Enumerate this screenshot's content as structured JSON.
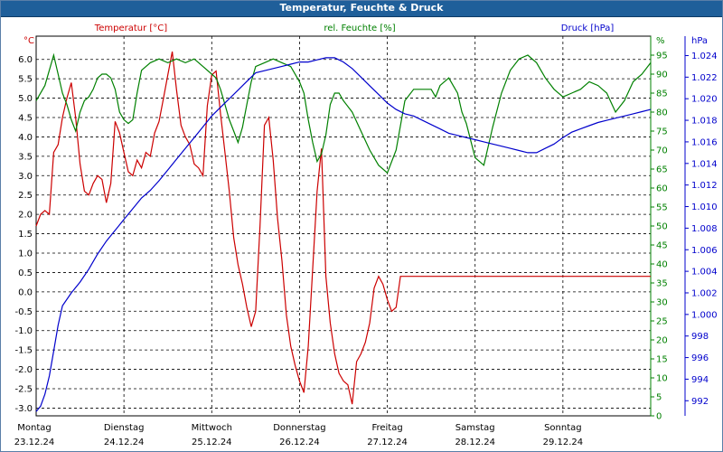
{
  "window": {
    "title": "Temperatur, Feuchte & Druck"
  },
  "colors": {
    "temperature": "#cc0000",
    "humidity": "#008000",
    "pressure": "#0000cc",
    "title_bg": "#1f5f9a",
    "axis_right": "#0000cc"
  },
  "chart_data": {
    "type": "line",
    "title": "Temperatur, Feuchte & Druck",
    "grid": true,
    "axes": {
      "temperature": {
        "label": "Temperatur [°C]",
        "unit": "°C",
        "range": [
          -3.2,
          6.6
        ],
        "ticks": [
          -3.0,
          -2.5,
          -2.0,
          -1.5,
          -1.0,
          -0.5,
          0.0,
          0.5,
          1.0,
          1.5,
          2.0,
          2.5,
          3.0,
          3.5,
          4.0,
          4.5,
          5.0,
          5.5,
          6.0
        ]
      },
      "humidity": {
        "label": "rel. Feuchte [%]",
        "unit": "%",
        "range": [
          0,
          100
        ],
        "ticks": [
          0,
          5,
          10,
          15,
          20,
          25,
          30,
          35,
          40,
          45,
          50,
          55,
          60,
          65,
          70,
          75,
          80,
          85,
          90,
          95
        ]
      },
      "pressure": {
        "label": "Druck [hPa]",
        "unit": "hPa",
        "range": [
          990.6,
          1025.8
        ],
        "ticks": [
          992,
          994,
          996,
          998,
          1000,
          1002,
          1004,
          1006,
          1008,
          1010,
          1012,
          1014,
          1016,
          1018,
          1020,
          1022,
          1024
        ]
      }
    },
    "x_range": [
      0,
      7
    ],
    "days": [
      {
        "day": "Montag",
        "date": "23.12.24"
      },
      {
        "day": "Dienstag",
        "date": "24.12.24"
      },
      {
        "day": "Mittwoch",
        "date": "25.12.24"
      },
      {
        "day": "Donnerstag",
        "date": "26.12.24"
      },
      {
        "day": "Freitag",
        "date": "27.12.24"
      },
      {
        "day": "Samstag",
        "date": "28.12.24"
      },
      {
        "day": "Sonntag",
        "date": "29.12.24"
      }
    ],
    "series": [
      {
        "name": "Temperatur [°C]",
        "axis": "temperature",
        "x": [
          0.0,
          0.05,
          0.1,
          0.15,
          0.2,
          0.25,
          0.3,
          0.35,
          0.4,
          0.45,
          0.5,
          0.55,
          0.6,
          0.65,
          0.7,
          0.75,
          0.8,
          0.85,
          0.9,
          0.95,
          1.0,
          1.05,
          1.1,
          1.15,
          1.2,
          1.25,
          1.3,
          1.35,
          1.4,
          1.45,
          1.5,
          1.55,
          1.6,
          1.65,
          1.7,
          1.75,
          1.8,
          1.85,
          1.9,
          1.95,
          2.0,
          2.05,
          2.1,
          2.15,
          2.2,
          2.25,
          2.3,
          2.35,
          2.4,
          2.45,
          2.5,
          2.55,
          2.6,
          2.65,
          2.7,
          2.75,
          2.8,
          2.85,
          2.9,
          2.95,
          3.0,
          3.05,
          3.1,
          3.15,
          3.2,
          3.25,
          3.3,
          3.35,
          3.4,
          3.45,
          3.5,
          3.55,
          3.6,
          3.65,
          3.7,
          3.75,
          3.8,
          3.85,
          3.9,
          3.95,
          4.0,
          4.05,
          4.1,
          4.15,
          4.2,
          4.25,
          4.3,
          4.35,
          4.4,
          4.45,
          4.5,
          4.55,
          4.6,
          4.65,
          4.7,
          4.75,
          4.8,
          4.85,
          4.9,
          4.95,
          5.0,
          5.05,
          5.1,
          5.15,
          5.2,
          5.25,
          5.3,
          5.35,
          5.4,
          5.45,
          5.5,
          5.55,
          5.6,
          5.65,
          5.7,
          5.75,
          5.8,
          5.85,
          5.9,
          5.95,
          6.0,
          6.05,
          6.1,
          6.15,
          6.2,
          6.25,
          6.3,
          6.35,
          6.4,
          6.45,
          6.5,
          6.55,
          6.6,
          6.65,
          6.7,
          6.75,
          6.8,
          6.85,
          6.9,
          6.95,
          7.0
        ],
        "values": [
          1.7,
          2.0,
          2.1,
          2.0,
          3.6,
          3.8,
          4.5,
          5.0,
          5.4,
          4.5,
          3.3,
          2.6,
          2.5,
          2.8,
          3.0,
          2.9,
          2.3,
          2.8,
          4.4,
          4.1,
          3.6,
          3.1,
          3.0,
          3.4,
          3.2,
          3.6,
          3.5,
          4.1,
          4.4,
          5.0,
          5.6,
          6.2,
          5.2,
          4.3,
          4.0,
          3.8,
          3.3,
          3.2,
          3.0,
          4.8,
          5.6,
          5.7,
          4.6,
          3.6,
          2.6,
          1.4,
          0.7,
          0.2,
          -0.4,
          -0.9,
          -0.5,
          1.7,
          4.3,
          4.5,
          3.4,
          1.9,
          0.8,
          -0.6,
          -1.4,
          -1.9,
          -2.3,
          -2.6,
          -1.4,
          0.6,
          2.6,
          3.7,
          0.4,
          -0.8,
          -1.6,
          -2.1,
          -2.3,
          -2.4,
          -2.9,
          -1.8,
          -1.6,
          -1.3,
          -0.8,
          0.1,
          0.4,
          0.2,
          -0.2,
          -0.5,
          -0.4,
          0.4,
          0.4,
          0.4,
          0.4,
          0.4,
          0.4,
          0.4,
          0.4,
          0.4,
          0.4,
          0.4,
          0.4,
          0.4,
          0.4,
          0.4,
          0.4,
          0.4,
          0.4,
          0.4,
          0.4,
          0.4,
          0.4,
          0.4,
          0.4,
          0.4,
          0.4,
          0.4,
          0.4,
          0.4,
          0.4,
          0.4,
          0.4,
          0.4,
          0.4,
          0.4,
          0.4,
          0.4,
          0.4,
          0.4,
          0.4,
          0.4,
          0.4,
          0.4,
          0.4,
          0.4,
          0.4,
          0.4,
          0.4,
          0.4,
          0.4,
          0.4,
          0.4,
          0.4,
          0.4,
          0.4,
          0.4,
          0.4,
          0.4
        ]
      },
      {
        "name": "rel. Feuchte [%]",
        "axis": "humidity",
        "x": [
          0.0,
          0.1,
          0.2,
          0.25,
          0.3,
          0.35,
          0.4,
          0.45,
          0.5,
          0.55,
          0.6,
          0.65,
          0.7,
          0.75,
          0.8,
          0.85,
          0.9,
          0.95,
          1.0,
          1.05,
          1.1,
          1.15,
          1.2,
          1.3,
          1.4,
          1.5,
          1.6,
          1.7,
          1.8,
          1.9,
          2.0,
          2.05,
          2.1,
          2.15,
          2.2,
          2.25,
          2.3,
          2.35,
          2.4,
          2.45,
          2.5,
          2.6,
          2.7,
          2.8,
          2.9,
          3.0,
          3.05,
          3.1,
          3.15,
          3.2,
          3.25,
          3.3,
          3.35,
          3.4,
          3.45,
          3.5,
          3.6,
          3.7,
          3.8,
          3.9,
          4.0,
          4.1,
          4.2,
          4.3,
          4.4,
          4.5,
          4.55,
          4.6,
          4.65,
          4.7,
          4.75,
          4.8,
          4.85,
          4.9,
          5.0,
          5.1,
          5.2,
          5.3,
          5.4,
          5.5,
          5.6,
          5.7,
          5.8,
          5.9,
          6.0,
          6.1,
          6.2,
          6.3,
          6.4,
          6.5,
          6.6,
          6.7,
          6.8,
          6.9,
          7.0
        ],
        "values": [
          83,
          87,
          95,
          90,
          85,
          82,
          78,
          75,
          80,
          83,
          84,
          86,
          89,
          90,
          90,
          89,
          86,
          80,
          78,
          77,
          78,
          85,
          91,
          93,
          94,
          93,
          94,
          93,
          94,
          92,
          90,
          89,
          86,
          82,
          78,
          75,
          72,
          76,
          82,
          88,
          92,
          93,
          94,
          93,
          92,
          88,
          85,
          78,
          72,
          67,
          69,
          74,
          82,
          85,
          85,
          83,
          80,
          75,
          70,
          66,
          64,
          70,
          83,
          86,
          86,
          86,
          84,
          87,
          88,
          89,
          87,
          85,
          80,
          77,
          68,
          66,
          76,
          85,
          91,
          94,
          95,
          93,
          89,
          86,
          84,
          85,
          86,
          88,
          87,
          85,
          80,
          83,
          88,
          90,
          93
        ]
      },
      {
        "name": "Druck [hPa]",
        "axis": "pressure",
        "x": [
          0.0,
          0.05,
          0.1,
          0.15,
          0.2,
          0.25,
          0.3,
          0.4,
          0.5,
          0.6,
          0.7,
          0.8,
          0.9,
          1.0,
          1.1,
          1.2,
          1.3,
          1.4,
          1.5,
          1.6,
          1.7,
          1.8,
          1.9,
          2.0,
          2.1,
          2.2,
          2.3,
          2.4,
          2.5,
          2.6,
          2.7,
          2.8,
          2.9,
          3.0,
          3.1,
          3.2,
          3.3,
          3.4,
          3.5,
          3.6,
          3.7,
          3.8,
          3.9,
          4.0,
          4.1,
          4.2,
          4.3,
          4.4,
          4.5,
          4.6,
          4.7,
          4.8,
          4.9,
          5.0,
          5.1,
          5.2,
          5.3,
          5.4,
          5.5,
          5.6,
          5.7,
          5.8,
          5.9,
          6.0,
          6.1,
          6.2,
          6.3,
          6.4,
          6.5,
          6.6,
          6.7,
          6.8,
          6.9,
          7.0
        ],
        "values": [
          991.0,
          991.5,
          992.6,
          994.3,
          996.6,
          999.0,
          1000.8,
          1002.0,
          1003.0,
          1004.2,
          1005.6,
          1006.8,
          1007.8,
          1008.8,
          1009.8,
          1010.8,
          1011.5,
          1012.4,
          1013.4,
          1014.4,
          1015.4,
          1016.4,
          1017.4,
          1018.4,
          1019.2,
          1020.0,
          1020.8,
          1021.6,
          1022.4,
          1022.6,
          1022.8,
          1023.0,
          1023.2,
          1023.4,
          1023.4,
          1023.6,
          1023.8,
          1023.8,
          1023.4,
          1022.8,
          1022.0,
          1021.2,
          1020.4,
          1019.6,
          1019.0,
          1018.6,
          1018.4,
          1018.0,
          1017.6,
          1017.2,
          1016.8,
          1016.6,
          1016.4,
          1016.2,
          1016.0,
          1015.8,
          1015.6,
          1015.4,
          1015.2,
          1015.0,
          1015.0,
          1015.4,
          1015.8,
          1016.4,
          1016.9,
          1017.2,
          1017.5,
          1017.8,
          1018.0,
          1018.2,
          1018.4,
          1018.6,
          1018.8,
          1019.0
        ]
      }
    ]
  }
}
